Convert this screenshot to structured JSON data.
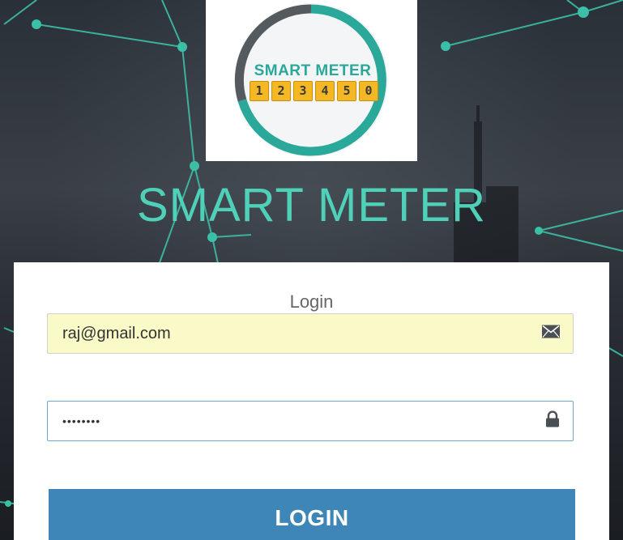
{
  "logo": {
    "brand_text": "SMART METER",
    "digits": [
      "1",
      "2",
      "3",
      "4",
      "5",
      "0"
    ]
  },
  "app_title": "SMART METER",
  "login_card": {
    "title": "Login",
    "email": {
      "value": "raj@gmail.com",
      "icon": "envelope-icon"
    },
    "password": {
      "value": "••••••••",
      "icon": "lock-icon"
    },
    "submit_label": "LOGIN"
  },
  "colors": {
    "accent_teal": "#4fd1b9",
    "button_blue": "#3e86b8",
    "digit_yellow": "#f5b825"
  }
}
